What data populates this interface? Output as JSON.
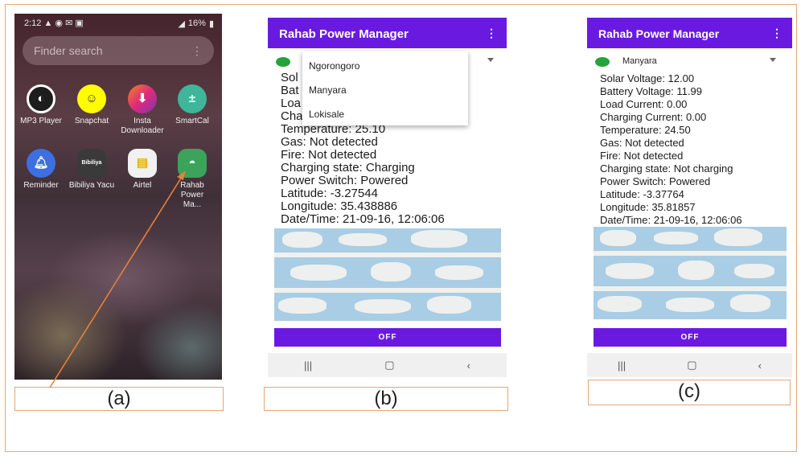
{
  "panel_a": {
    "status_time": "2:12",
    "status_battery": "16%",
    "search_placeholder": "Finder search",
    "apps_row1": [
      "MP3 Player",
      "Snapchat",
      "Insta Downloader",
      "SmartCal"
    ],
    "apps_row2": [
      "Reminder",
      "Bibiliya Yacu",
      "Airtel",
      "Rahab Power Ma..."
    ],
    "caption": "(a)"
  },
  "app_title": "Rahab Power Manager",
  "panel_b": {
    "dropdown_options": [
      "Ngorongoro",
      "Manyara",
      "Lokisale"
    ],
    "partial_labels": [
      "Sol",
      "Bat",
      "Loa",
      "Cha"
    ],
    "readings": [
      "Temperature: 25.10",
      "Gas: Not detected",
      "Fire: Not detected",
      "Charging state: Charging",
      "Power Switch: Powered",
      "Latitude: -3.27544",
      "Longitude: 35.438886",
      "Date/Time: 21-09-16, 12:06:06"
    ],
    "button": "OFF",
    "caption": "(b)"
  },
  "panel_c": {
    "selected_site": "Manyara",
    "readings": [
      "Solar Voltage: 12.00",
      "Battery Voltage: 11.99",
      "Load Current: 0.00",
      "Charging Current: 0.00",
      "Temperature: 24.50",
      "Gas: Not detected",
      "Fire: Not detected",
      "Charging state: Not charging",
      "Power Switch: Powered",
      "Latitude: -3.37764",
      "Longitude: 35.81857",
      "Date/Time: 21-09-16, 12:06:06"
    ],
    "button": "OFF",
    "caption": "(c)"
  },
  "colors": {
    "accent": "#6a1ae0",
    "border": "#e2a77a",
    "arrow": "#e8803a"
  }
}
